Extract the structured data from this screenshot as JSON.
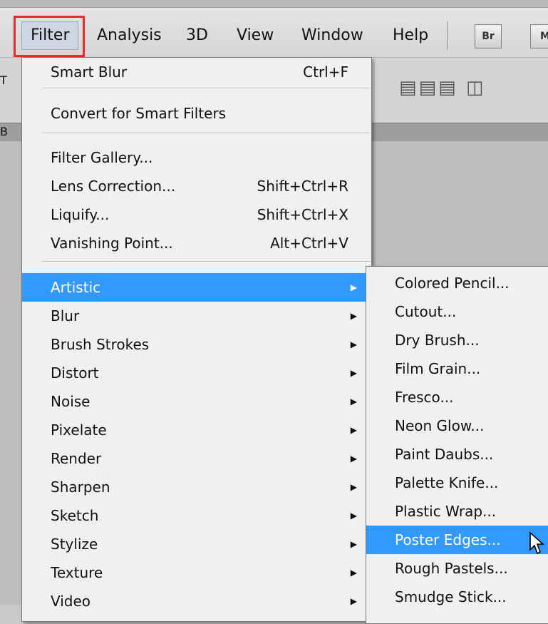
{
  "menubar": {
    "items": [
      "Filter",
      "Analysis",
      "3D",
      "View",
      "Window",
      "Help"
    ],
    "badges": [
      "Br",
      "M"
    ]
  },
  "toolbar": {
    "left_fragment": "T",
    "tab_fragment": "B"
  },
  "filter_menu": {
    "top_items": [
      {
        "label": "Smart Blur",
        "shortcut": "Ctrl+F"
      },
      {
        "label": "Convert for Smart Filters",
        "shortcut": ""
      },
      {
        "label": "Filter Gallery...",
        "shortcut": ""
      },
      {
        "label": "Lens Correction...",
        "shortcut": "Shift+Ctrl+R"
      },
      {
        "label": "Liquify...",
        "shortcut": "Shift+Ctrl+X"
      },
      {
        "label": "Vanishing Point...",
        "shortcut": "Alt+Ctrl+V"
      }
    ],
    "submenu_items": [
      "Artistic",
      "Blur",
      "Brush Strokes",
      "Distort",
      "Noise",
      "Pixelate",
      "Render",
      "Sharpen",
      "Sketch",
      "Stylize",
      "Texture",
      "Video"
    ],
    "highlighted": "Artistic"
  },
  "artistic_submenu": {
    "items": [
      "Colored Pencil...",
      "Cutout...",
      "Dry Brush...",
      "Film Grain...",
      "Fresco...",
      "Neon Glow...",
      "Paint Daubs...",
      "Palette Knife...",
      "Plastic Wrap...",
      "Poster Edges...",
      "Rough Pastels...",
      "Smudge Stick..."
    ],
    "highlighted": "Poster Edges..."
  },
  "colors": {
    "highlight": "#3399ff",
    "annotation": "#e52b2b",
    "menu_bg": "#f0f0f0"
  },
  "icons": [
    "submenu-arrow-icon",
    "mouse-pointer-icon",
    "align-icon"
  ]
}
